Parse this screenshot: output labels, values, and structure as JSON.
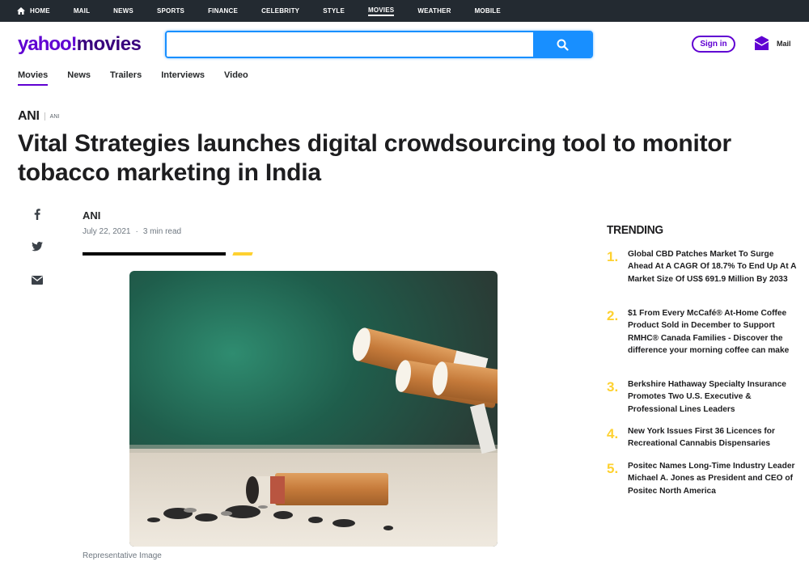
{
  "topnav": {
    "items": [
      "HOME",
      "MAIL",
      "NEWS",
      "SPORTS",
      "FINANCE",
      "CELEBRITY",
      "STYLE",
      "MOVIES",
      "WEATHER",
      "MOBILE"
    ],
    "active": "MOVIES"
  },
  "header": {
    "logo_yahoo": "yahoo!",
    "logo_section": "movies",
    "search_value": "",
    "signin_label": "Sign in",
    "mail_label": "Mail",
    "brand_color": "#6001d2",
    "search_color": "#188fff"
  },
  "subnav": {
    "items": [
      "Movies",
      "News",
      "Trailers",
      "Interviews",
      "Video"
    ],
    "active": "Movies"
  },
  "article": {
    "source_big": "ANI",
    "source_small": "ANI",
    "headline": "Vital Strategies launches digital crowdsourcing tool to monitor tobacco marketing in India",
    "author": "ANI",
    "date": "July 22, 2021",
    "read_time": "3 min read",
    "caption": "Representative Image",
    "share_icons": [
      "facebook-icon",
      "twitter-icon",
      "email-icon"
    ]
  },
  "trending": {
    "title": "TRENDING",
    "items": [
      {
        "num": "1.",
        "text": "Global CBD Patches Market To Surge Ahead At A CAGR Of 18.7% To End Up At A Market Size Of US$ 691.9 Million By 2033"
      },
      {
        "num": "2.",
        "text": "$1 From Every McCafé® At-Home Coffee Product Sold in December to Support RMHC® Canada Families - Discover the difference your morning coffee can make"
      },
      {
        "num": "3.",
        "text": "Berkshire Hathaway Specialty Insurance Promotes Two U.S. Executive & Professional Lines Leaders"
      },
      {
        "num": "4.",
        "text": "New York Issues First 36 Licences for Recreational Cannabis Dispensaries"
      },
      {
        "num": "5.",
        "text": "Positec Names Long-Time Industry Leader Michael A. Jones as President and CEO of Positec North America"
      }
    ]
  }
}
